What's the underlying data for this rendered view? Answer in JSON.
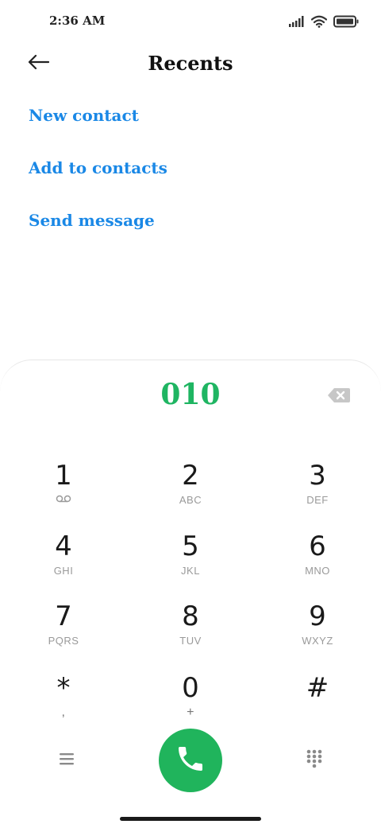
{
  "status": {
    "time": "2:36 AM"
  },
  "header": {
    "title": "Recents"
  },
  "actions": {
    "new_contact": "New contact",
    "add_to_contacts": "Add to contacts",
    "send_message": "Send message"
  },
  "dialer": {
    "number": "010",
    "keys": [
      {
        "digit": "1",
        "sub": ""
      },
      {
        "digit": "2",
        "sub": "ABC"
      },
      {
        "digit": "3",
        "sub": "DEF"
      },
      {
        "digit": "4",
        "sub": "GHI"
      },
      {
        "digit": "5",
        "sub": "JKL"
      },
      {
        "digit": "6",
        "sub": "MNO"
      },
      {
        "digit": "7",
        "sub": "PQRS"
      },
      {
        "digit": "8",
        "sub": "TUV"
      },
      {
        "digit": "9",
        "sub": "WXYZ"
      },
      {
        "digit": "*",
        "sub": ","
      },
      {
        "digit": "0",
        "sub": "+"
      },
      {
        "digit": "#",
        "sub": ""
      }
    ]
  },
  "icons": {
    "back": "arrow-left-icon",
    "backspace": "backspace-icon",
    "voicemail": "voicemail-icon",
    "menu": "menu-icon",
    "call": "phone-icon",
    "keypad": "keypad-icon"
  },
  "colors": {
    "accent_link": "#1a88e6",
    "number": "#1fb562",
    "call_button": "#20b45c"
  }
}
